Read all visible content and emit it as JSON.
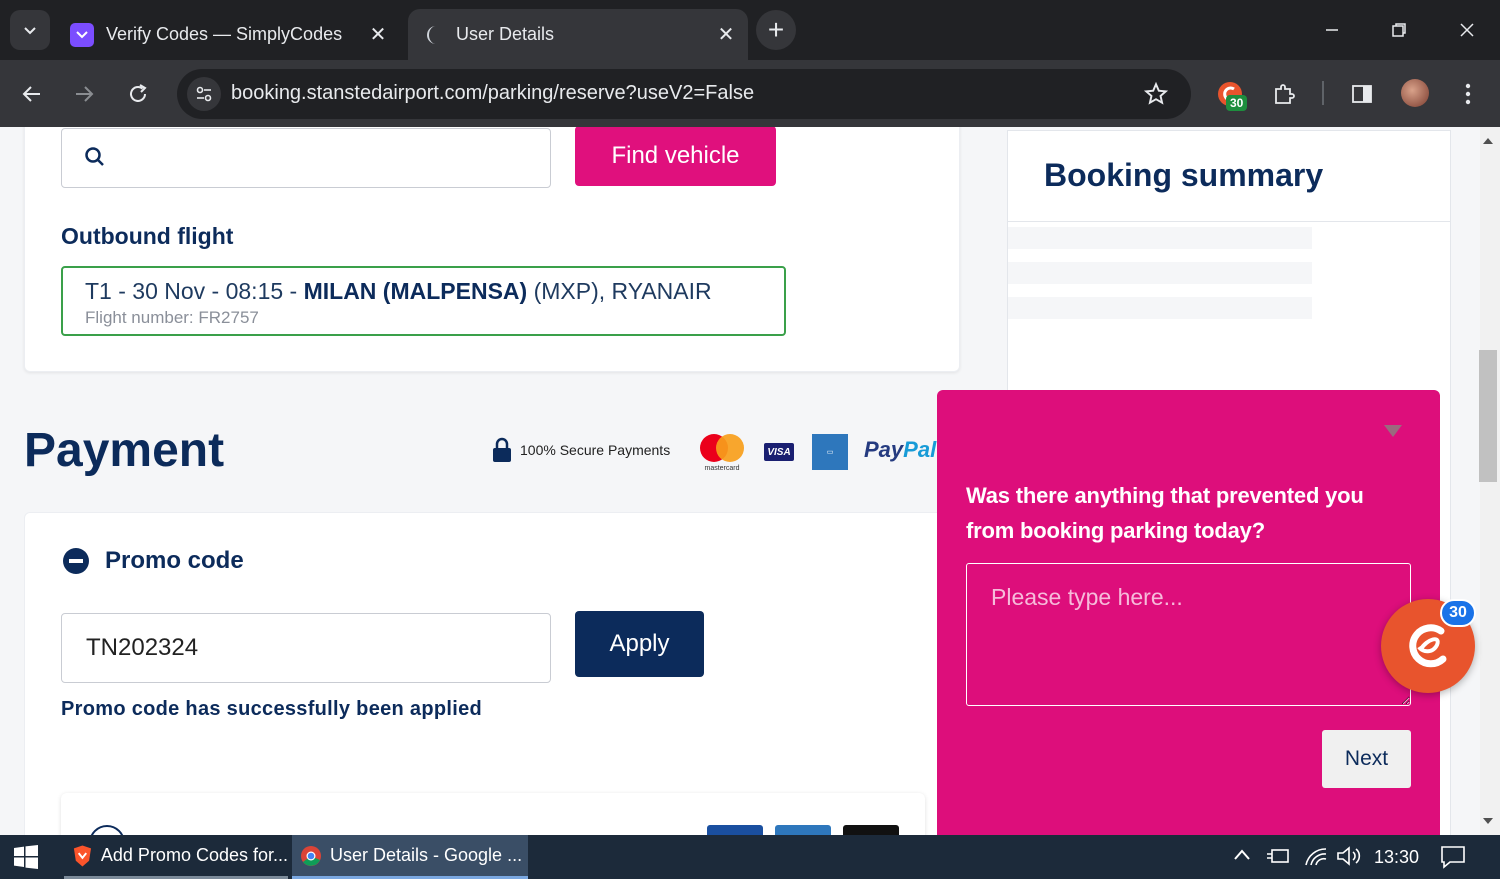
{
  "browser": {
    "tabs": [
      {
        "title": "Verify Codes — SimplyCodes",
        "active": false
      },
      {
        "title": "User Details",
        "active": true
      }
    ],
    "url": "booking.stanstedairport.com/parking/reserve?useV2=False",
    "extension_badge": "30"
  },
  "page": {
    "find_vehicle_label": "Find vehicle",
    "outbound_label": "Outbound flight",
    "flight": {
      "prefix": "T1 - 30 Nov - 08:15 - ",
      "destination": "MILAN (MALPENSA)",
      "suffix": " (MXP), RYANAIR",
      "number": "Flight number: FR2757"
    },
    "payment_title": "Payment",
    "secure_text": "100% Secure Payments",
    "card_logos": {
      "visa": "VISA",
      "paypal_a": "Pay",
      "paypal_b": "Pal"
    },
    "promo": {
      "label": "Promo code",
      "value": "TN202324",
      "apply_label": "Apply",
      "success": "Promo code has successfully been applied"
    },
    "summary_title": "Booking summary"
  },
  "survey": {
    "question": "Was there anything that prevented you from booking parking today?",
    "placeholder": "Please type here...",
    "next_label": "Next"
  },
  "floating_badge": "30",
  "taskbar": {
    "items": [
      {
        "label": "Add Promo Codes for..."
      },
      {
        "label": "User Details - Google ..."
      }
    ],
    "time": "13:30"
  },
  "colors": {
    "brand_pink": "#e0107d",
    "navy": "#0c2b5b",
    "success_green": "#3aa04a"
  }
}
